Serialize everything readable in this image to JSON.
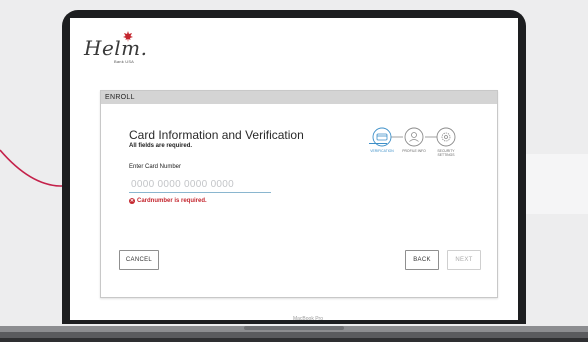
{
  "logo": {
    "brand": "Helm.",
    "subtitle": "Bank USA"
  },
  "enroll": {
    "header": "ENROLL",
    "title": "Card Information and Verification",
    "required_note": "All fields are required.",
    "field_label": "Enter Card Number",
    "card_placeholder": "0000 0000 0000 0000",
    "card_value": "",
    "error_text": "Cardnumber is required."
  },
  "steps": [
    {
      "label": "VERIFICATION",
      "icon": "card-icon",
      "active": true
    },
    {
      "label": "PROFILE INFO",
      "icon": "user-icon",
      "active": false
    },
    {
      "label": "SECURITY SETTINGS",
      "icon": "gear-icon",
      "active": false
    }
  ],
  "buttons": {
    "cancel": "CANCEL",
    "back": "BACK",
    "next": "NEXT"
  },
  "device": {
    "label": "MacBook Pro"
  },
  "colors": {
    "accent": "#3c8fc8",
    "error": "#c4262e",
    "callout": "#c4214a"
  }
}
